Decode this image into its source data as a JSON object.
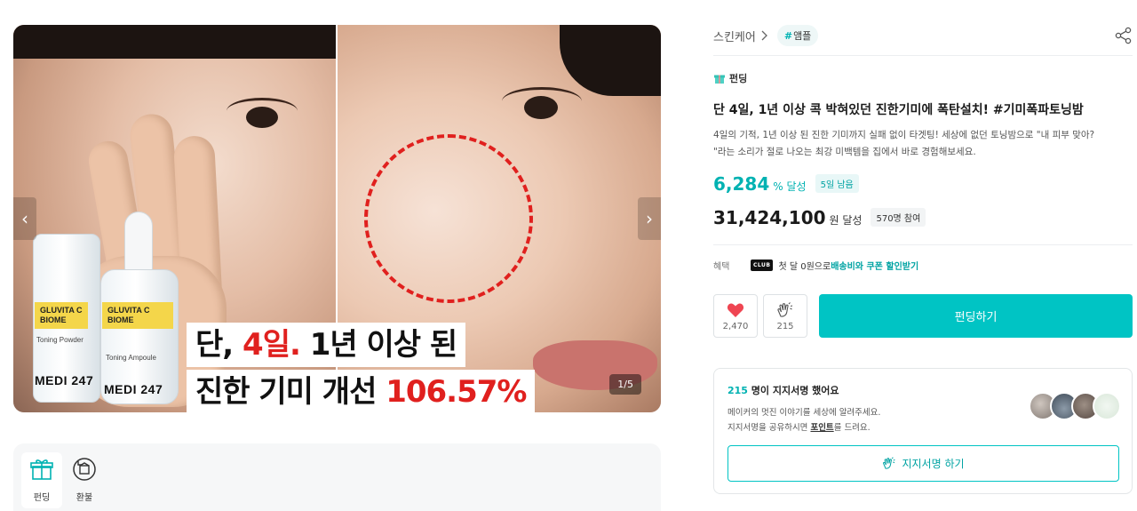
{
  "carousel": {
    "counter": "1/5",
    "prev_arrow": "‹",
    "next_arrow": "›",
    "products": [
      {
        "label_line1": "GLUVITA C",
        "label_line2": "BIOME",
        "sub": "Toning Powder",
        "brand": "MEDI 247"
      },
      {
        "label_line1": "GLUVITA C",
        "label_line2": "BIOME",
        "sub": "Toning Ampoule",
        "brand": "MEDI 247"
      }
    ],
    "caption": {
      "line1_prefix": "단, ",
      "line1_red": "4일.",
      "line1_suffix": " 1년 이상 된",
      "line2_prefix": "진한 기미 개선 ",
      "line2_red": "106.57%"
    }
  },
  "tabs": [
    {
      "label": "펀딩",
      "icon": "gift-icon",
      "active": true
    },
    {
      "label": "환불",
      "icon": "refund-icon",
      "active": false
    }
  ],
  "breadcrumb": {
    "category": "스킨케어",
    "tag": "앰플",
    "tag_hash": "#"
  },
  "badge": "펀딩",
  "title": "단 4일, 1년 이상 콕 박혀있던 진한기미에 폭탄설치! #기미폭파토닝밤",
  "summary_line1": "4일의 기적, 1년 이상 된 진한 기미까지 실패 없이 타겟팅! 세상에 없던 토닝밤으로 \"내 피부 맞아?",
  "summary_line2": "\"라는 소리가 절로 나오는 최강 미백템을 집에서 바로 경험해보세요.",
  "stats": {
    "rate_value": "6,284",
    "rate_unit": "% 달성",
    "days_left": "5일 남음",
    "amount_value": "31,424,100",
    "amount_unit": "원 달성",
    "participants": "570명 참여"
  },
  "benefit": {
    "label": "혜택",
    "club": "CLUB",
    "text_prefix": "첫 달 0원으로 ",
    "text_highlight": "배송비와 쿠폰 할인받기"
  },
  "actions": {
    "like_count": "2,470",
    "cheer_count": "215",
    "fund_button": "펀딩하기"
  },
  "support": {
    "count": "215",
    "title_suffix": " 명이 지지서명 했어요",
    "desc_line1": "메이커의 멋진 이야기를 세상에 알려주세요.",
    "desc_line2_prefix": "지지서명을 공유하시면 ",
    "desc_line2_point": "포인트",
    "desc_line2_suffix": "를 드려요.",
    "button": "지지서명 하기"
  },
  "colors": {
    "accent": "#00c4c4",
    "accent_text": "#00b2b2",
    "caption_red": "#e0201e",
    "label_yellow": "#f4d64a"
  }
}
